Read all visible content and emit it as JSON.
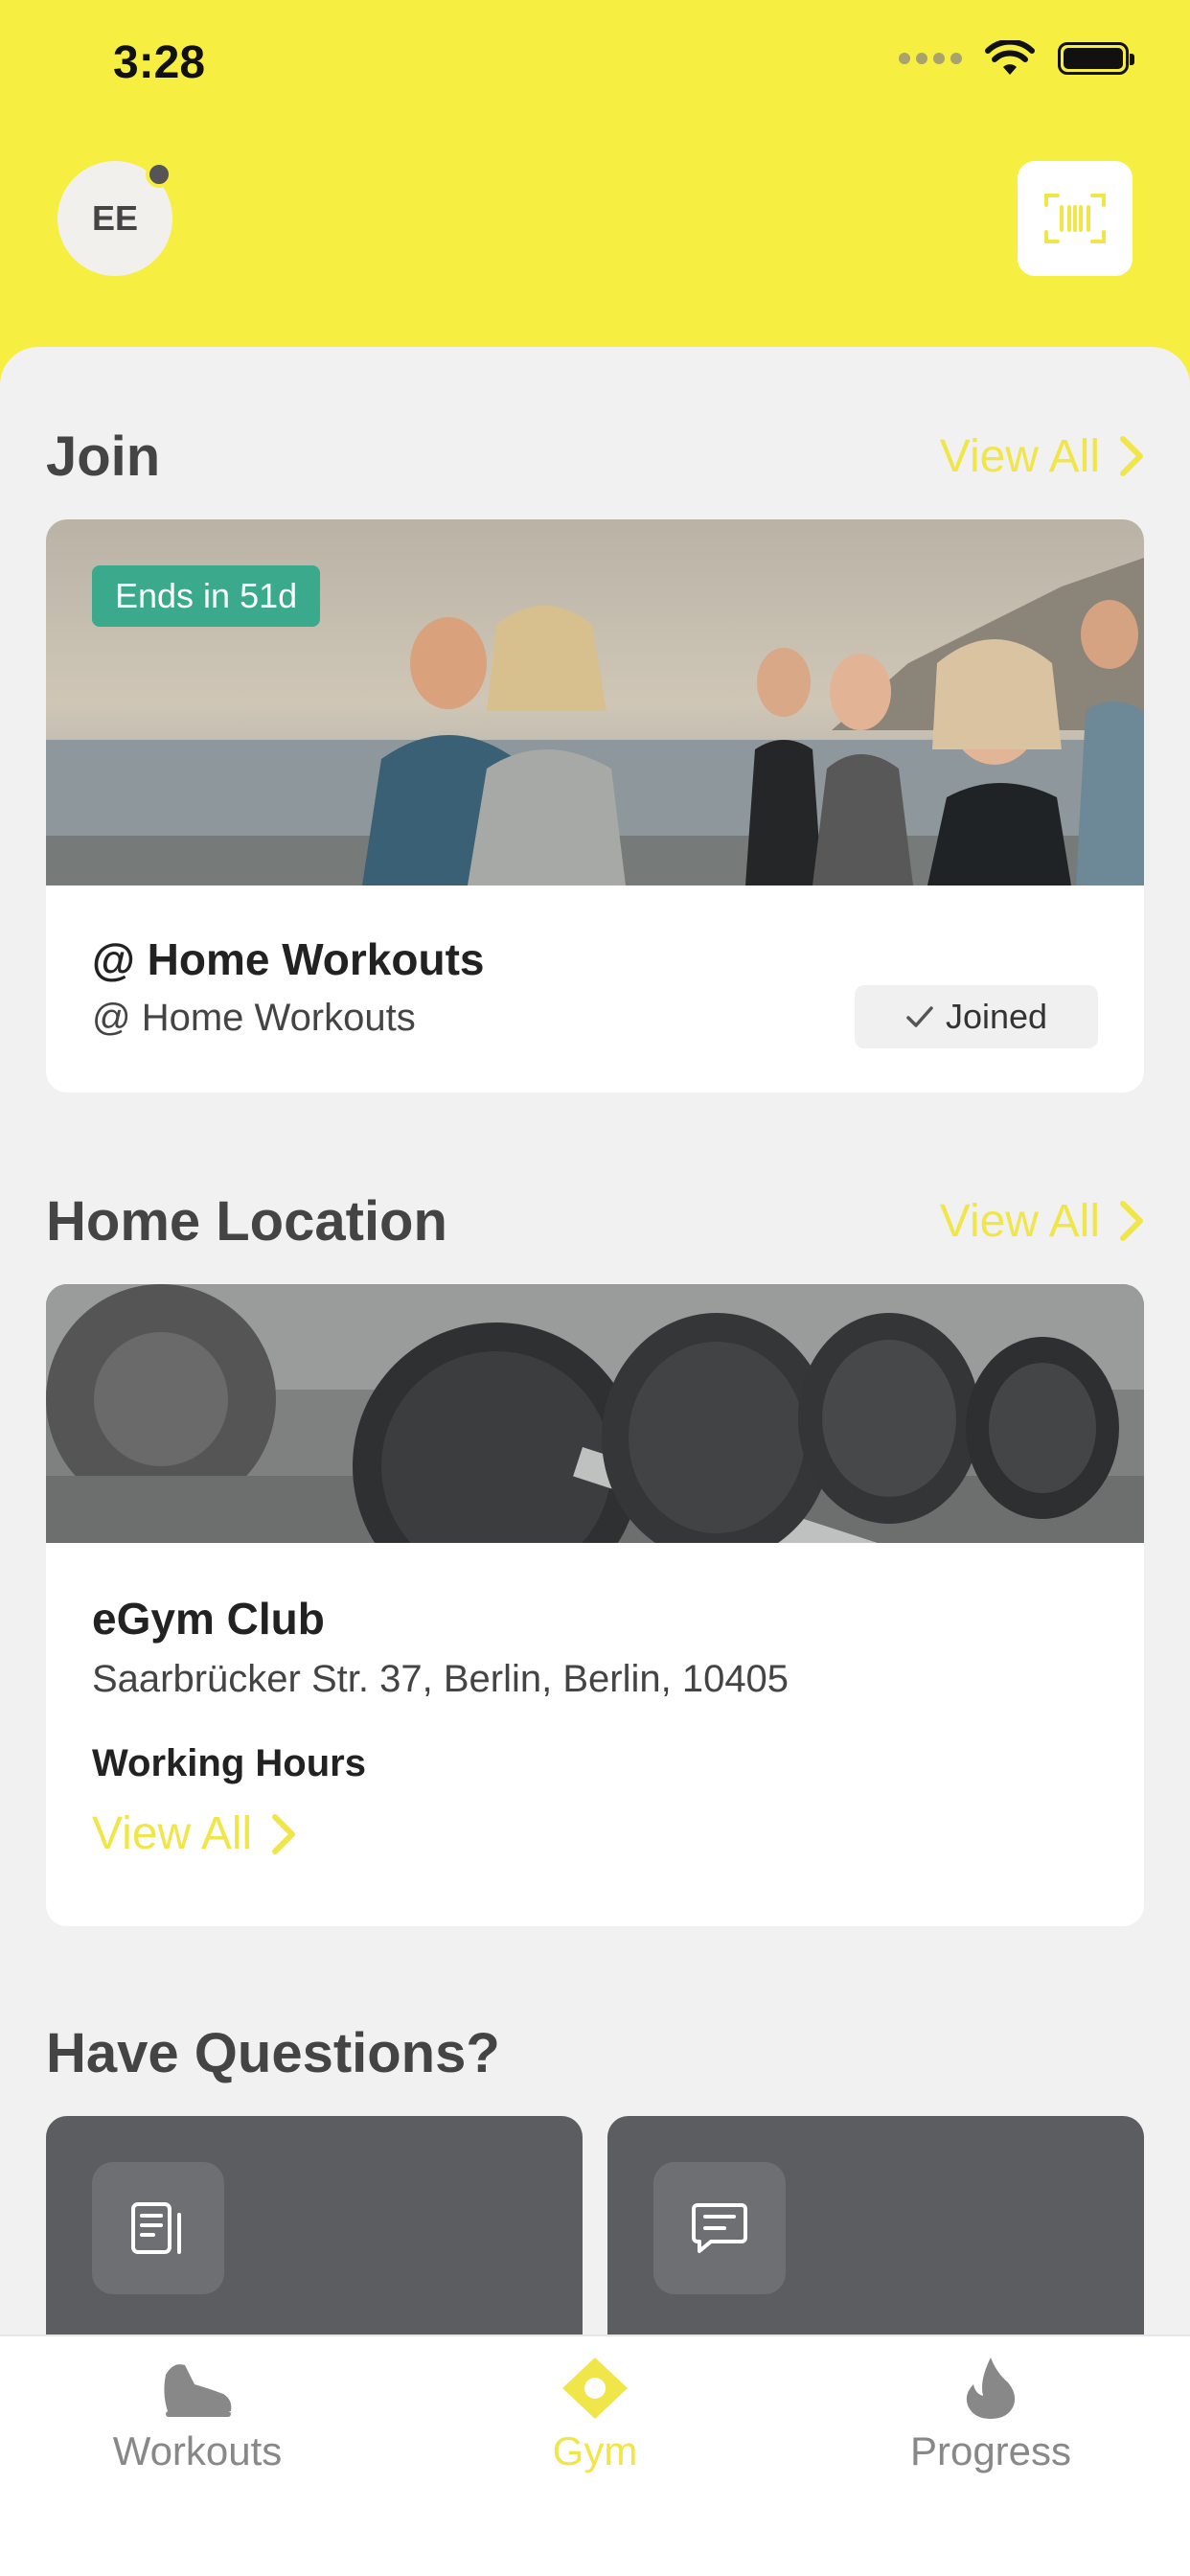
{
  "status_bar": {
    "time": "3:28"
  },
  "header": {
    "avatar_initials": "EE"
  },
  "join": {
    "title": "Join",
    "view_all": "View All",
    "card": {
      "badge": "Ends in 51d",
      "title": "@ Home Workouts",
      "subtitle": "@ Home Workouts",
      "status": "Joined"
    }
  },
  "home_location": {
    "title": "Home Location",
    "view_all": "View All",
    "card": {
      "name": "eGym Club",
      "address": "Saarbrücker Str. 37, Berlin, Berlin, 10405",
      "hours_label": "Working Hours",
      "hours_link": "View All"
    }
  },
  "questions": {
    "title": "Have Questions?"
  },
  "tabs": [
    {
      "label": "Workouts",
      "icon": "shoe-icon"
    },
    {
      "label": "Gym",
      "icon": "gym-pin-icon"
    },
    {
      "label": "Progress",
      "icon": "flame-icon"
    }
  ],
  "colors": {
    "accent": "#F0E64A",
    "header_bg": "#F7EE42",
    "badge": "#3BAA8C",
    "question_card": "#5C5D60"
  }
}
